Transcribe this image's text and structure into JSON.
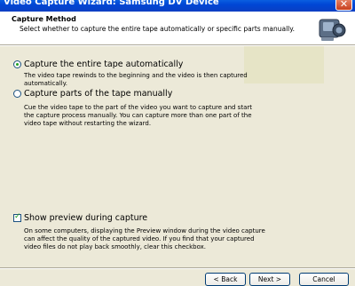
{
  "window": {
    "title": "Video Capture Wizard: Samsung DV Device",
    "close_label": "✕"
  },
  "header": {
    "title": "Capture Method",
    "subtitle": "Select whether to capture the entire tape automatically or specific parts manually."
  },
  "options": [
    {
      "label": "Capture the entire tape automatically",
      "checked": true,
      "description_lines": [
        "The video tape rewinds to the beginning and the video is then captured",
        "automatically."
      ]
    },
    {
      "label": "Capture parts of the tape manually",
      "checked": false,
      "description_lines": [
        "Cue the video tape to the part of the video you want to capture and start",
        "the capture process manually. You can capture more than one part of the",
        "video tape without restarting the wizard."
      ]
    }
  ],
  "preview": {
    "label": "Show preview during capture",
    "checked": true,
    "description_lines": [
      "On some computers, displaying the Preview window during the video capture",
      "can affect the quality of the captured video. If you find that your captured",
      "video files do not play back smoothly, clear this checkbox."
    ]
  },
  "buttons": {
    "back": "< Back",
    "next": "Next >",
    "cancel": "Cancel"
  }
}
